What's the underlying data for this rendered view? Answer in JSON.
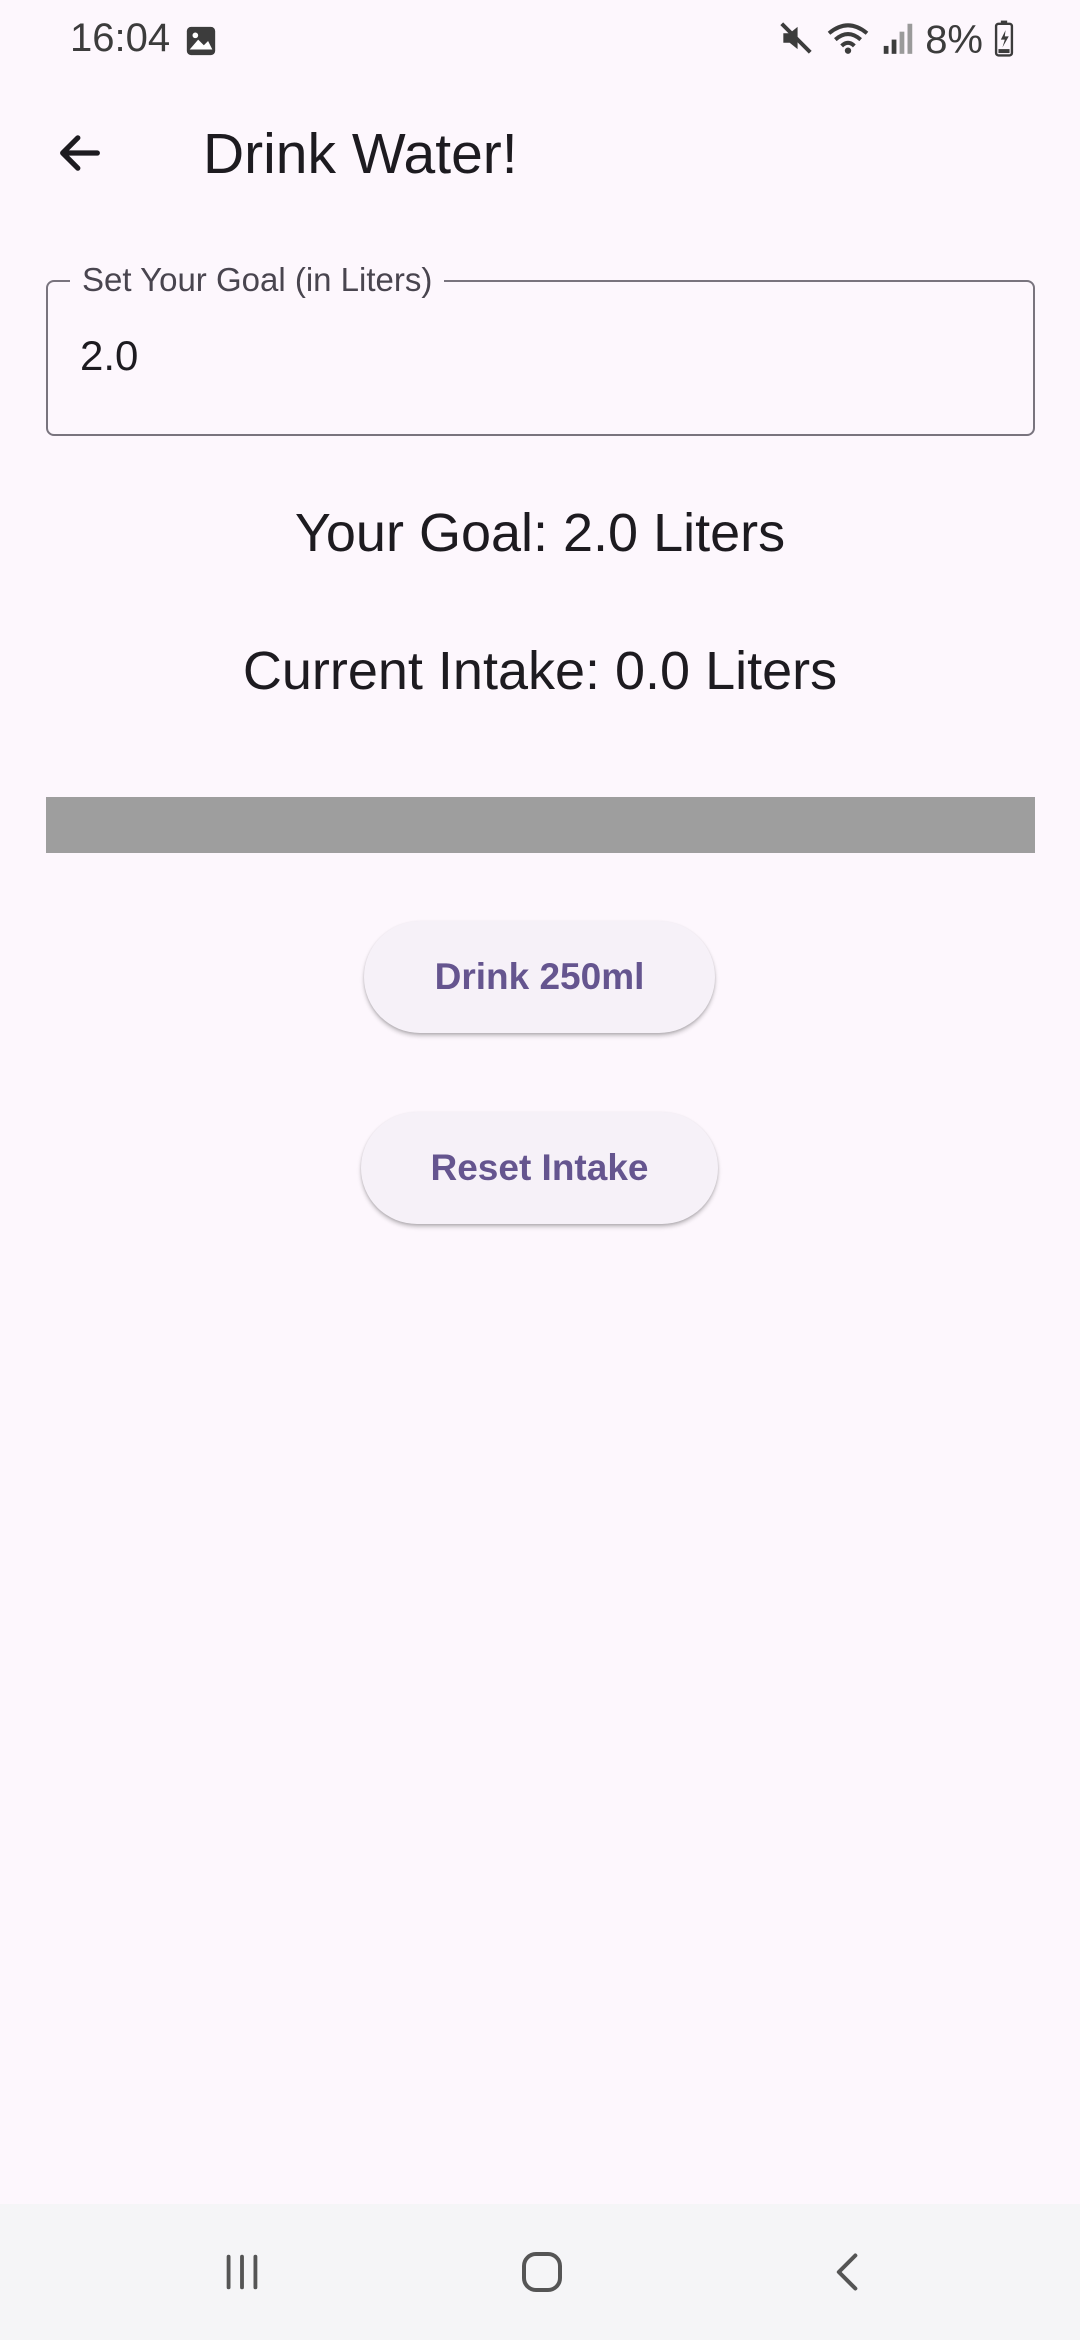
{
  "status_bar": {
    "time": "16:04",
    "battery": "8%",
    "icons": [
      "gallery-icon",
      "mute-icon",
      "wifi-icon",
      "signal-icon",
      "battery-icon"
    ]
  },
  "app_bar": {
    "title": "Drink Water!",
    "back_icon": "arrow-back-icon"
  },
  "goal_field": {
    "label": "Set Your Goal (in Liters)",
    "value": "2.0"
  },
  "summary": {
    "goal_text": "Your Goal: 2.0 Liters",
    "intake_text": "Current Intake: 0.0 Liters"
  },
  "progress": {
    "value": 0.0,
    "track_color": "#9e9e9e"
  },
  "actions": {
    "drink_label": "Drink 250ml",
    "reset_label": "Reset Intake"
  },
  "colors": {
    "accent": "#65558f",
    "background": "#fdf7fd"
  },
  "nav_bar": {
    "icons": [
      "recent-apps-icon",
      "home-icon",
      "back-icon"
    ]
  }
}
